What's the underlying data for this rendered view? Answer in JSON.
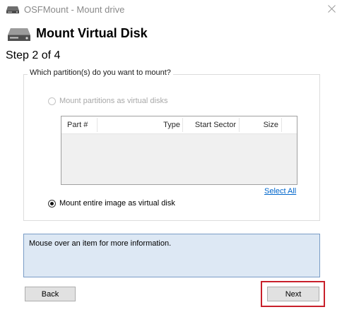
{
  "window": {
    "title": "OSFMount - Mount drive",
    "app_icon": "disk-drive-icon",
    "close_icon": "close-icon"
  },
  "header": {
    "icon": "disk-drive-icon",
    "title": "Mount Virtual Disk",
    "step": "Step 2 of 4"
  },
  "group": {
    "legend": "Which partition(s) do you want to mount?",
    "option_partitions": {
      "label": "Mount partitions as virtual disks",
      "selected": false,
      "enabled": false
    },
    "option_entire": {
      "label": "Mount entire image as virtual disk",
      "selected": true,
      "enabled": true
    },
    "table": {
      "columns": [
        "Part #",
        "Type",
        "Start Sector",
        "Size"
      ],
      "rows": []
    },
    "select_all": "Select All"
  },
  "info": {
    "text": "Mouse over an item for more information."
  },
  "buttons": {
    "back": "Back",
    "next": "Next"
  },
  "colors": {
    "info_background": "#dde8f4",
    "info_border": "#7a9cc6",
    "link": "#0066cc",
    "highlight": "#c8202b",
    "disabled_text": "#a8a8a8"
  }
}
